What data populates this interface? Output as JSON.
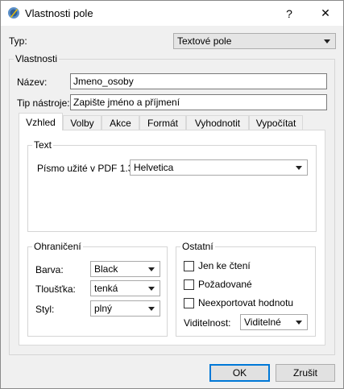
{
  "window": {
    "title": "Vlastnosti pole",
    "help_label": "?",
    "close_label": "✕"
  },
  "type_row": {
    "label": "Typ:",
    "value": "Textové pole"
  },
  "properties": {
    "group_title": "Vlastnosti",
    "name_label": "Název:",
    "name_value": "Jmeno_osoby",
    "tooltip_label": "Tip nástroje:",
    "tooltip_value": "Zapište jméno a příjmení"
  },
  "tabs": [
    {
      "label": "Vzhled",
      "active": true
    },
    {
      "label": "Volby",
      "active": false
    },
    {
      "label": "Akce",
      "active": false
    },
    {
      "label": "Formát",
      "active": false
    },
    {
      "label": "Vyhodnotit",
      "active": false
    },
    {
      "label": "Vypočítat",
      "active": false
    }
  ],
  "text_group": {
    "title": "Text",
    "font_label": "Písmo užité v PDF 1.3:",
    "font_value": "Helvetica"
  },
  "border_group": {
    "title": "Ohraničení",
    "color_label": "Barva:",
    "color_value": "Black",
    "thickness_label": "Tloušťka:",
    "thickness_value": "tenká",
    "style_label": "Styl:",
    "style_value": "plný"
  },
  "other_group": {
    "title": "Ostatní",
    "read_only_label": "Jen ke čtení",
    "read_only_checked": false,
    "required_label": "Požadované",
    "required_checked": false,
    "no_export_label": "Neexportovat hodnotu",
    "no_export_checked": false,
    "visibility_label": "Viditelnost:",
    "visibility_value": "Viditelné"
  },
  "footer": {
    "ok_label": "OK",
    "cancel_label": "Zrušit"
  }
}
